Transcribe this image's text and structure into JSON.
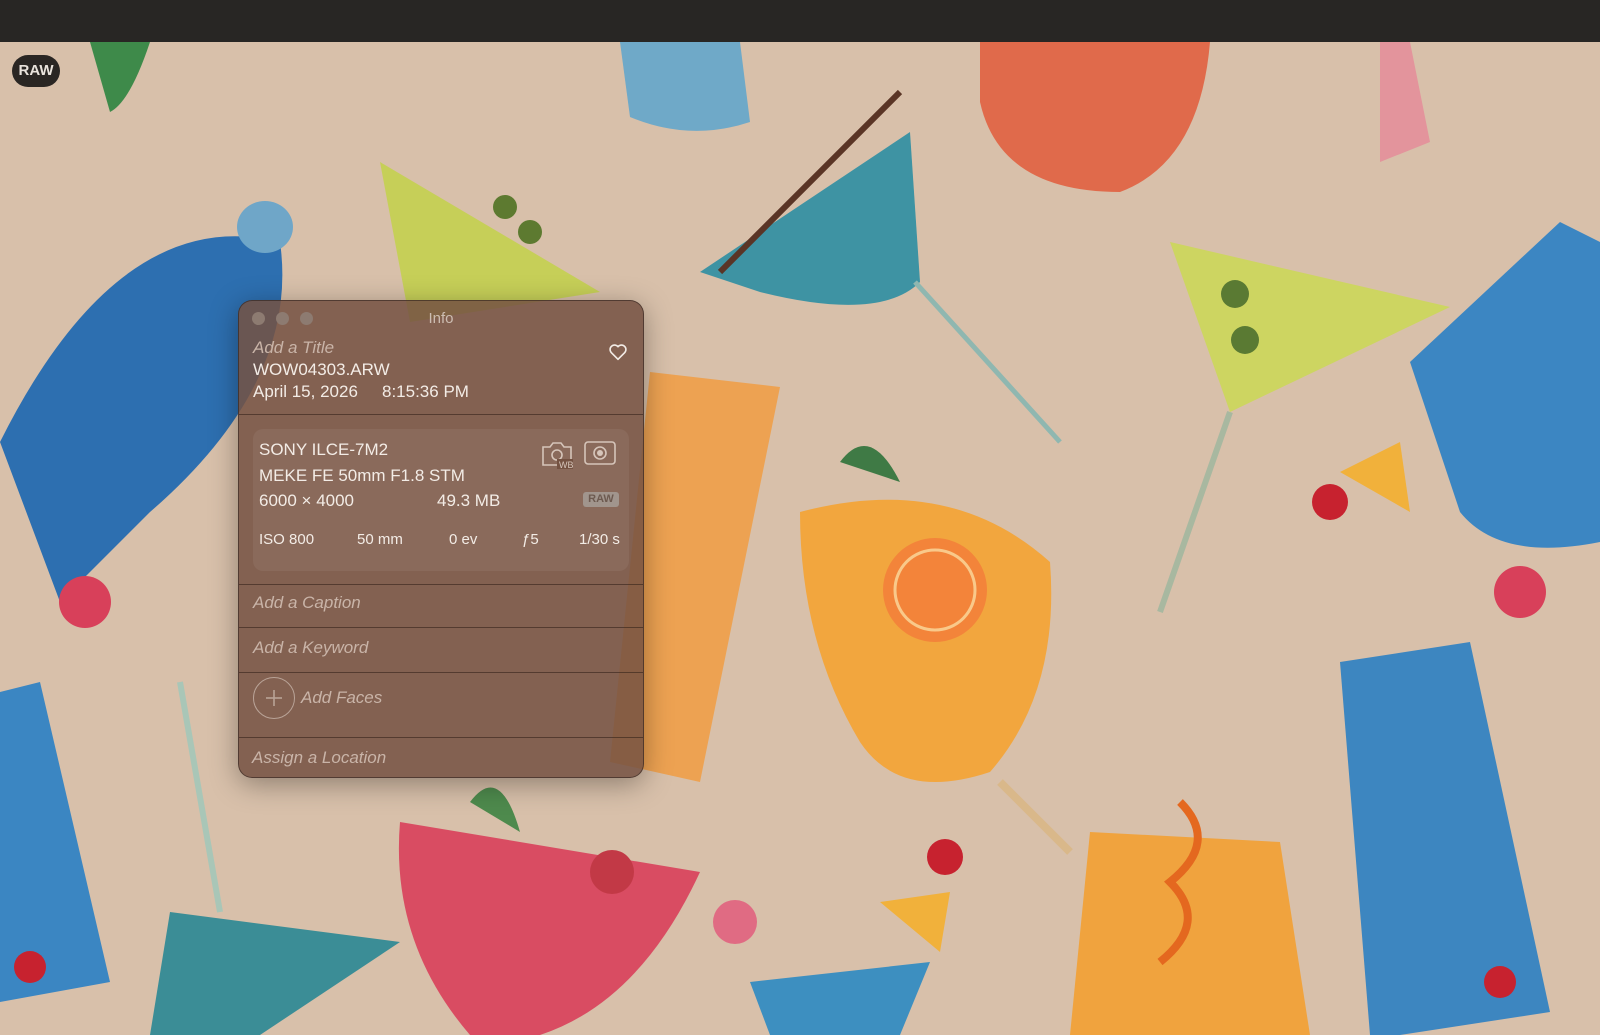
{
  "app": {
    "badge": "RAW"
  },
  "info_window": {
    "window_title": "Info",
    "title_placeholder": "Add a Title",
    "filename": "WOW04303.ARW",
    "date": "April 15, 2026",
    "time": "8:15:36 PM",
    "camera": {
      "model": "SONY ILCE-7M2",
      "lens": "MEKE FE 50mm F1.8 STM",
      "dimensions": "6000 × 4000",
      "file_size": "49.3 MB",
      "format_tag": "RAW",
      "icons": [
        "camera-wb-icon",
        "metering-icon"
      ]
    },
    "exif": {
      "iso": "ISO 800",
      "focal_length": "50 mm",
      "exposure_bias": "0 ev",
      "aperture": "ƒ5",
      "shutter": "1/30 s"
    },
    "caption_placeholder": "Add a Caption",
    "keyword_placeholder": "Add a Keyword",
    "faces_label": "Add Faces",
    "location_placeholder": "Assign a Location"
  },
  "colors": {
    "panel_bg": "#745242",
    "photo_bg": "#d9c1ab"
  }
}
